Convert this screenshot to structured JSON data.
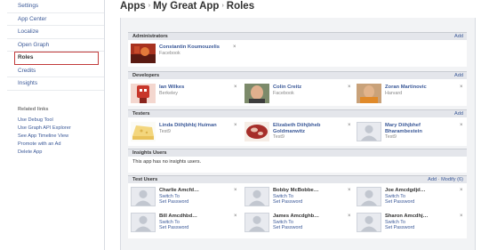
{
  "nav": {
    "items": [
      "Settings",
      "App Center",
      "Localize",
      "Open Graph",
      "Roles",
      "Credits",
      "Insights"
    ]
  },
  "related": {
    "title": "Related links",
    "links": [
      "Use Debug Tool",
      "Use Graph API Explorer",
      "See App Timeline View",
      "Promote with an Ad",
      "Delete App"
    ]
  },
  "breadcrumb": {
    "root": "Apps",
    "app": "My Great App",
    "page": "Roles",
    "separator": "›"
  },
  "remove_glyph": "×",
  "sections": {
    "administrators": {
      "title": "Administrators",
      "action": "Add",
      "people": [
        {
          "name": "Constantin Koumouzelis",
          "sub": "Facebook",
          "photo": "red-photo"
        }
      ]
    },
    "developers": {
      "title": "Developers",
      "action": "Add",
      "people": [
        {
          "name": "Ian Wilkes",
          "sub": "Berkeley",
          "photo": "red-robot-avatar"
        },
        {
          "name": "Colin Creitz",
          "sub": "Facebook",
          "photo": "man-photo"
        },
        {
          "name": "Zoran Martinovic",
          "sub": "Harvard",
          "photo": "man-orange-photo"
        }
      ]
    },
    "testers": {
      "title": "Testers",
      "action": "Add",
      "people": [
        {
          "name": "Linda Diihjbhbj Huiman",
          "sub": "Test9",
          "photo": "cheese-photo"
        },
        {
          "name": "Elizabeth Diihjbheb Goldmanwitz",
          "sub": "Test9",
          "photo": "meat-photo"
        },
        {
          "name": "Mary Diihjbhef Bharambestein",
          "sub": "Test9",
          "photo": "silhouette"
        }
      ]
    },
    "insights": {
      "title": "Insights Users",
      "empty": "This app has no insights users."
    },
    "test_users": {
      "title": "Test Users",
      "add": "Add",
      "modify": "Modify (6)",
      "action_sep": "·",
      "switch_label": "Switch To",
      "password_label": "Set Password",
      "people": [
        {
          "name": "Charlie Amcfd…"
        },
        {
          "name": "Bobby McBobbe…"
        },
        {
          "name": "Joe Amcdgdjd…"
        },
        {
          "name": "Bill Amcdhbd…"
        },
        {
          "name": "James Amcdghb…"
        },
        {
          "name": "Sharon Amcdhj…"
        }
      ]
    }
  }
}
